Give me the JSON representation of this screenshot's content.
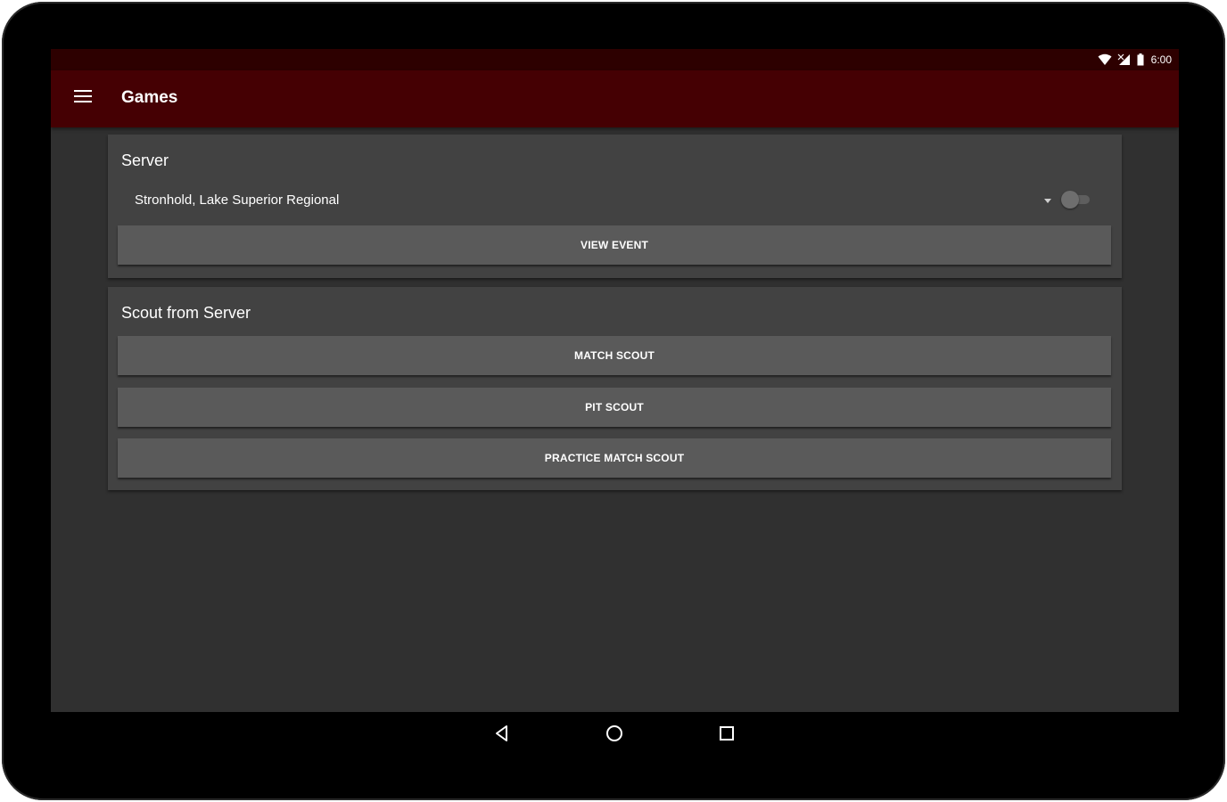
{
  "status_bar": {
    "time": "6:00",
    "icons": [
      "wifi-icon",
      "signal-icon",
      "battery-icon"
    ]
  },
  "app_bar": {
    "title": "Games",
    "menu_icon": "hamburger-menu-icon"
  },
  "server_card": {
    "title": "Server",
    "selected_event": "Stronhold, Lake Superior Regional",
    "toggle_on": false,
    "view_event_label": "VIEW EVENT"
  },
  "scout_card": {
    "title": "Scout from Server",
    "buttons": [
      {
        "label": "MATCH SCOUT"
      },
      {
        "label": "PIT SCOUT"
      },
      {
        "label": "PRACTICE MATCH SCOUT"
      }
    ]
  },
  "nav_bar": {
    "icons": [
      "back-icon",
      "home-icon",
      "recents-icon"
    ]
  },
  "colors": {
    "status_bar": "#2d0000",
    "app_bar": "#450003",
    "background": "#303030",
    "card": "#424242",
    "button": "#5a5a5a"
  }
}
